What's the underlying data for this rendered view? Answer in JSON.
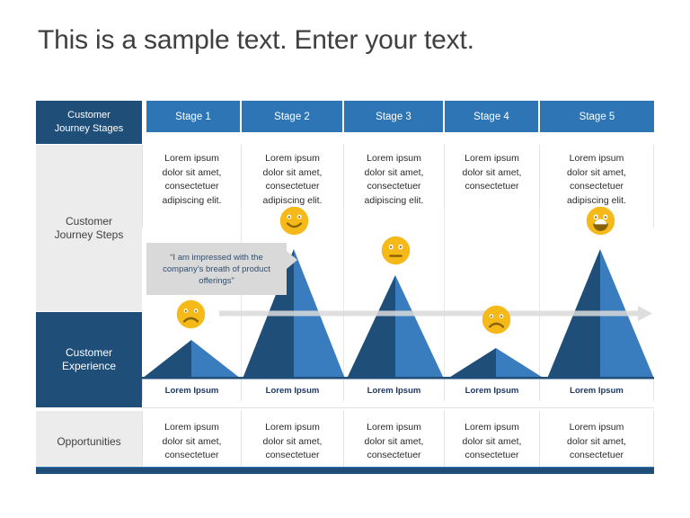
{
  "slide": {
    "title": "This is a sample text. Enter your text.",
    "accent_navy": "#1F4E79",
    "accent_blue": "#2E75B6",
    "accent_light_blue": "#3A7DBF",
    "gray": "#ECECEC",
    "emoji_yellow": "#F5B919"
  },
  "rows": [
    {
      "id": "journey-stages",
      "label_line1": "Customer",
      "label_line2": "Journey Stages",
      "style": "navy"
    },
    {
      "id": "journey-steps",
      "label_line1": "Customer",
      "label_line2": "Journey Steps",
      "style": "gray"
    },
    {
      "id": "customer-experience",
      "label_line1": "Customer",
      "label_line2": "Experience",
      "style": "navy"
    },
    {
      "id": "opportunities",
      "label_line1": "Opportunities",
      "label_line2": "",
      "style": "gray"
    }
  ],
  "stages": [
    {
      "header": "Stage 1"
    },
    {
      "header": "Stage 2"
    },
    {
      "header": "Stage 3"
    },
    {
      "header": "Stage 4"
    },
    {
      "header": "Stage 5"
    }
  ],
  "journey_steps": [
    {
      "l1": "Lorem ipsum",
      "l2": "dolor sit amet,",
      "l3": "consectetuer",
      "l4": "adipiscing elit."
    },
    {
      "l1": "Lorem ipsum",
      "l2": "dolor sit amet,",
      "l3": "consectetuer",
      "l4": "adipiscing elit."
    },
    {
      "l1": "Lorem ipsum",
      "l2": "dolor sit amet,",
      "l3": "consectetuer",
      "l4": "adipiscing elit."
    },
    {
      "l1": "Lorem ipsum",
      "l2": "dolor sit amet,",
      "l3": "consectetuer",
      "l4": ""
    },
    {
      "l1": "Lorem ipsum",
      "l2": "dolor sit amet,",
      "l3": "consectetuer",
      "l4": "adipiscing elit."
    }
  ],
  "experience_labels": [
    {
      "text": "Lorem Ipsum"
    },
    {
      "text": "Lorem Ipsum"
    },
    {
      "text": "Lorem Ipsum"
    },
    {
      "text": "Lorem Ipsum"
    },
    {
      "text": "Lorem Ipsum"
    }
  ],
  "opportunities": [
    {
      "l1": "Lorem ipsum",
      "l2": "dolor sit amet,",
      "l3": "consectetuer"
    },
    {
      "l1": "Lorem ipsum",
      "l2": "dolor sit amet,",
      "l3": "consectetuer"
    },
    {
      "l1": "Lorem ipsum",
      "l2": "dolor sit amet,",
      "l3": "consectetuer"
    },
    {
      "l1": "Lorem ipsum",
      "l2": "dolor sit amet,",
      "l3": "consectetuer"
    },
    {
      "l1": "Lorem ipsum",
      "l2": "dolor sit amet,",
      "l3": "consectetuer"
    }
  ],
  "callout": {
    "line1": "“I am impressed with the",
    "line2": "company’s breath of product",
    "line3": "offerings”"
  },
  "chart_data": {
    "type": "area",
    "title": "Customer Experience",
    "categories": [
      "Stage 1",
      "Stage 2",
      "Stage 3",
      "Stage 4",
      "Stage 5"
    ],
    "values": [
      22,
      76,
      62,
      17,
      76
    ],
    "ylim": [
      0,
      100
    ],
    "grid": true,
    "xlabel": "",
    "ylabel": "",
    "sentiments": [
      "sad",
      "smile",
      "neutral",
      "sad",
      "grin"
    ],
    "annotations": [
      "Lorem Ipsum",
      "Lorem Ipsum",
      "Lorem Ipsum",
      "Lorem Ipsum",
      "Lorem Ipsum"
    ],
    "arrow": {
      "direction": "right",
      "label": ""
    }
  }
}
